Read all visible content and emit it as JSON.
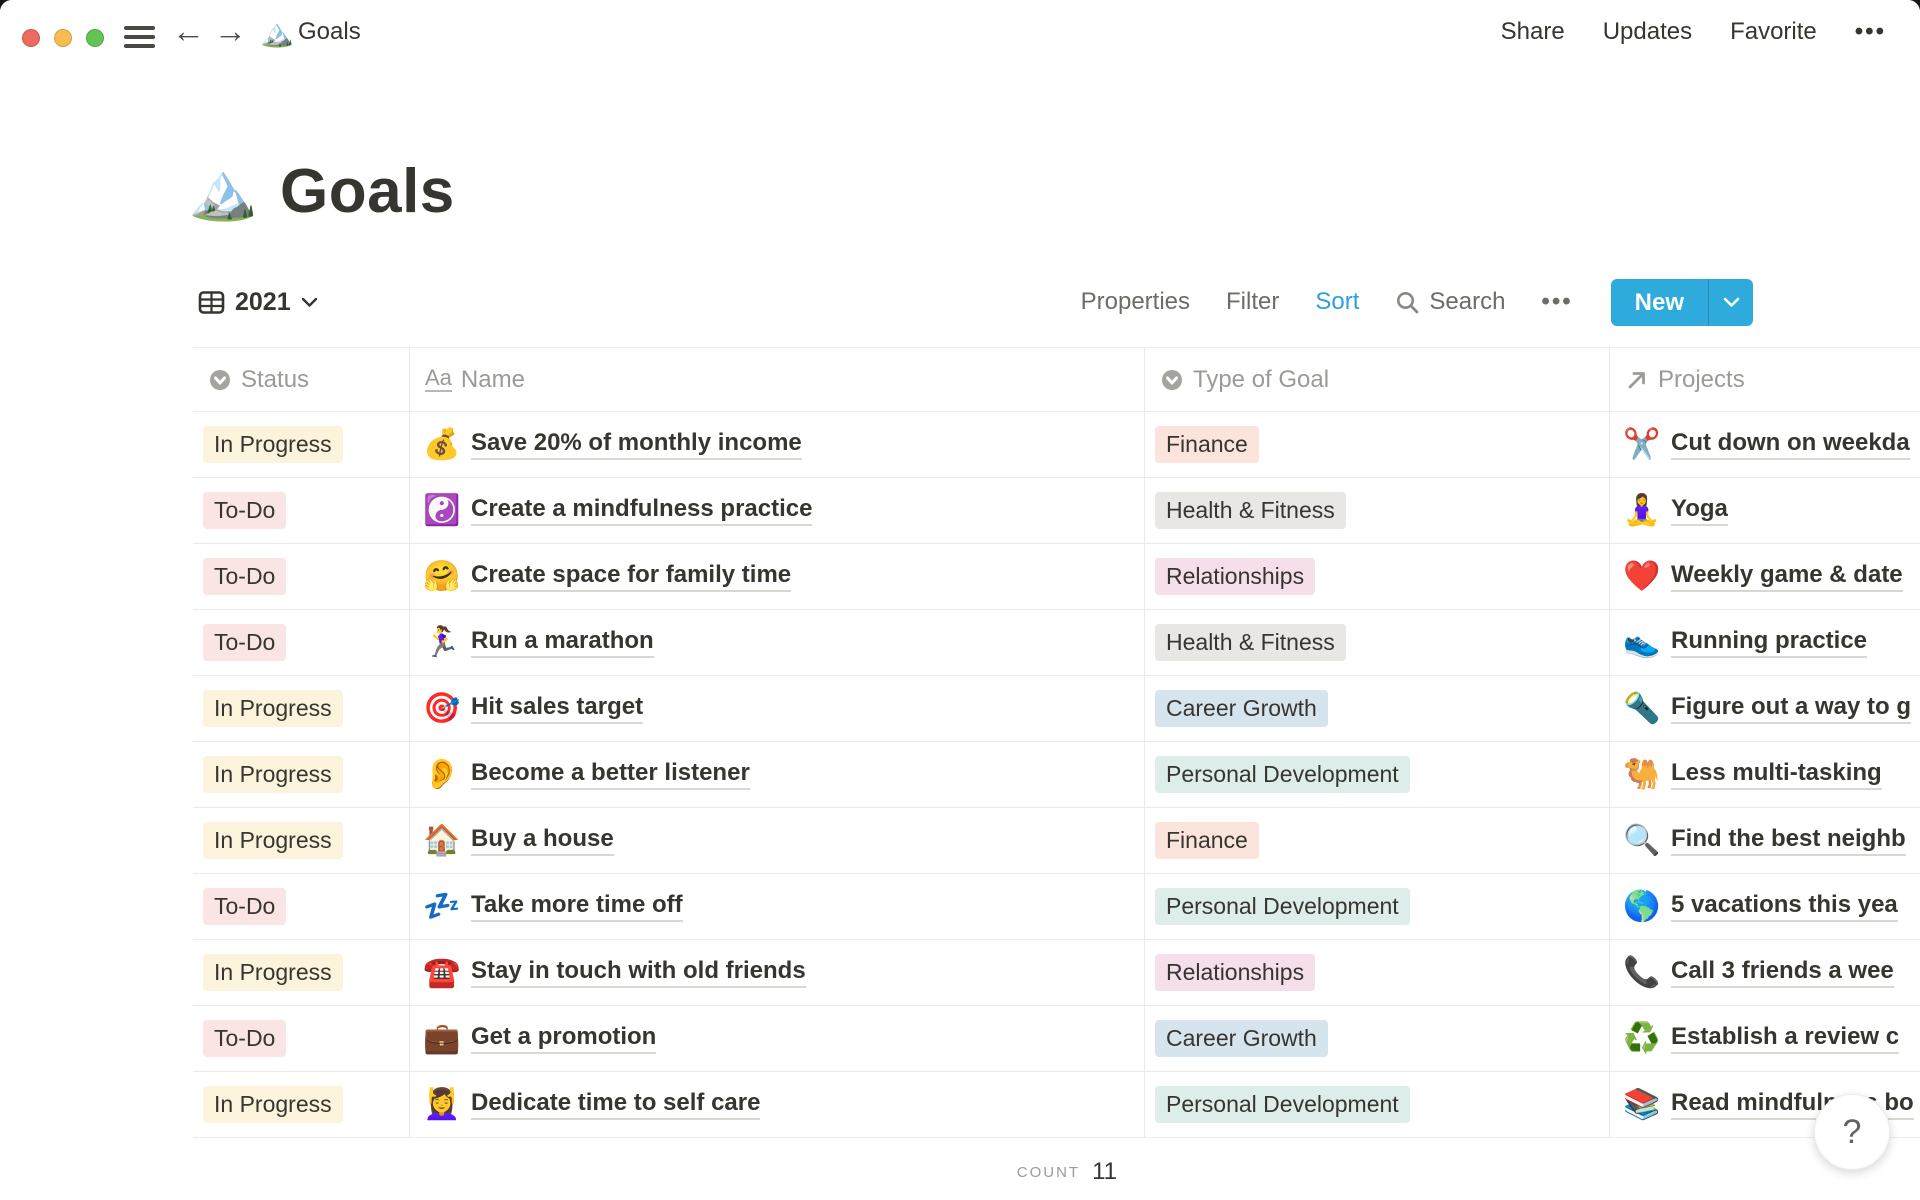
{
  "titlebar": {
    "breadcrumb": {
      "icon": "🏔️",
      "label": "Goals"
    },
    "menu": {
      "share": "Share",
      "updates": "Updates",
      "favorite": "Favorite",
      "more": "•••"
    }
  },
  "page": {
    "icon": "🏔️",
    "title": "Goals"
  },
  "toolbar": {
    "view_name": "2021",
    "properties": "Properties",
    "filter": "Filter",
    "sort": "Sort",
    "search": "Search",
    "more": "•••",
    "new_label": "New"
  },
  "colors": {
    "accent_blue": "#2EAADC",
    "sort_active": "#2E9FE0",
    "badge_yellow": "#FBF3DB",
    "badge_red": "#FBE4E4",
    "badge_orange": "#FAE4DC",
    "badge_gray": "#E8E7E4",
    "badge_pink": "#F4DFEB",
    "badge_blue": "#D6E4EE",
    "badge_green": "#DDEDEA"
  },
  "table": {
    "columns": [
      {
        "label": "Status",
        "icon": "select-icon"
      },
      {
        "label": "Name",
        "icon": "text-icon"
      },
      {
        "label": "Type of Goal",
        "icon": "select-icon"
      },
      {
        "label": "Projects",
        "icon": "relation-icon"
      }
    ],
    "rows": [
      {
        "status": "In Progress",
        "status_color": "yellow",
        "name_icon": "💰",
        "name": "Save 20% of monthly income",
        "type": "Finance",
        "type_color": "orange",
        "project_icon": "✂️",
        "project": "Cut down on weekda"
      },
      {
        "status": "To-Do",
        "status_color": "red",
        "name_icon": "☯️",
        "name": "Create a mindfulness practice",
        "type": "Health & Fitness",
        "type_color": "gray",
        "project_icon": "🧘‍♀️",
        "project": "Yoga"
      },
      {
        "status": "To-Do",
        "status_color": "red",
        "name_icon": "🤗",
        "name": "Create space for family time",
        "type": "Relationships",
        "type_color": "pink",
        "project_icon": "❤️",
        "project": "Weekly game & date"
      },
      {
        "status": "To-Do",
        "status_color": "red",
        "name_icon": "🏃‍♀️",
        "name": "Run a marathon",
        "type": "Health & Fitness",
        "type_color": "gray",
        "project_icon": "👟",
        "project": "Running practice"
      },
      {
        "status": "In Progress",
        "status_color": "yellow",
        "name_icon": "🎯",
        "name": "Hit sales target",
        "type": "Career Growth",
        "type_color": "blue",
        "project_icon": "🔦",
        "project": "Figure out a way to g"
      },
      {
        "status": "In Progress",
        "status_color": "yellow",
        "name_icon": "👂",
        "name": "Become a better listener",
        "type": "Personal Development",
        "type_color": "green",
        "project_icon": "🐫",
        "project": "Less multi-tasking"
      },
      {
        "status": "In Progress",
        "status_color": "yellow",
        "name_icon": "🏠",
        "name": "Buy a house",
        "type": "Finance",
        "type_color": "orange",
        "project_icon": "🔍",
        "project": "Find the best neighb"
      },
      {
        "status": "To-Do",
        "status_color": "red",
        "name_icon": "💤",
        "name": "Take more time off",
        "type": "Personal Development",
        "type_color": "green",
        "project_icon": "🌎",
        "project": "5 vacations this yea"
      },
      {
        "status": "In Progress",
        "status_color": "yellow",
        "name_icon": "☎️",
        "name": "Stay in touch with old friends",
        "type": "Relationships",
        "type_color": "pink",
        "project_icon": "📞",
        "project": "Call 3 friends a wee"
      },
      {
        "status": "To-Do",
        "status_color": "red",
        "name_icon": "💼",
        "name": "Get a promotion",
        "type": "Career Growth",
        "type_color": "blue",
        "project_icon": "♻️",
        "project": "Establish a review c"
      },
      {
        "status": "In Progress",
        "status_color": "yellow",
        "name_icon": "💆‍♀️",
        "name": "Dedicate time to self care",
        "type": "Personal Development",
        "type_color": "green",
        "project_icon": "📚",
        "project": "Read mindfulness bo"
      }
    ],
    "footer": {
      "count_label": "COUNT",
      "count_value": "11"
    }
  },
  "help": {
    "label": "?"
  }
}
